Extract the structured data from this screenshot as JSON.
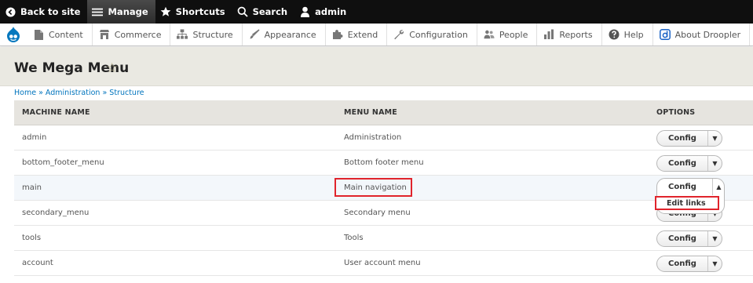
{
  "toolbar": {
    "back": "Back to site",
    "manage": "Manage",
    "shortcuts": "Shortcuts",
    "search": "Search",
    "user": "admin"
  },
  "tray": {
    "items": [
      "Content",
      "Commerce",
      "Structure",
      "Appearance",
      "Extend",
      "Configuration",
      "People",
      "Reports",
      "Help",
      "About Droopler"
    ]
  },
  "page": {
    "title": "We Mega Menu",
    "star": "☆"
  },
  "breadcrumb": [
    "Home",
    "Administration",
    "Structure"
  ],
  "table": {
    "headers": [
      "MACHINE NAME",
      "MENU NAME",
      "OPTIONS"
    ],
    "rows": [
      {
        "machine": "admin",
        "menu": "Administration"
      },
      {
        "machine": "bottom_footer_menu",
        "menu": "Bottom footer menu"
      },
      {
        "machine": "main",
        "menu": "Main navigation"
      },
      {
        "machine": "secondary_menu",
        "menu": "Secondary menu"
      },
      {
        "machine": "tools",
        "menu": "Tools"
      },
      {
        "machine": "account",
        "menu": "User account menu"
      }
    ],
    "action_label": "Config",
    "dropdown_item": "Edit links"
  },
  "colors": {
    "toolbar": "#0f0f0f",
    "link": "#0074bd",
    "highlight": "#e0242c"
  }
}
